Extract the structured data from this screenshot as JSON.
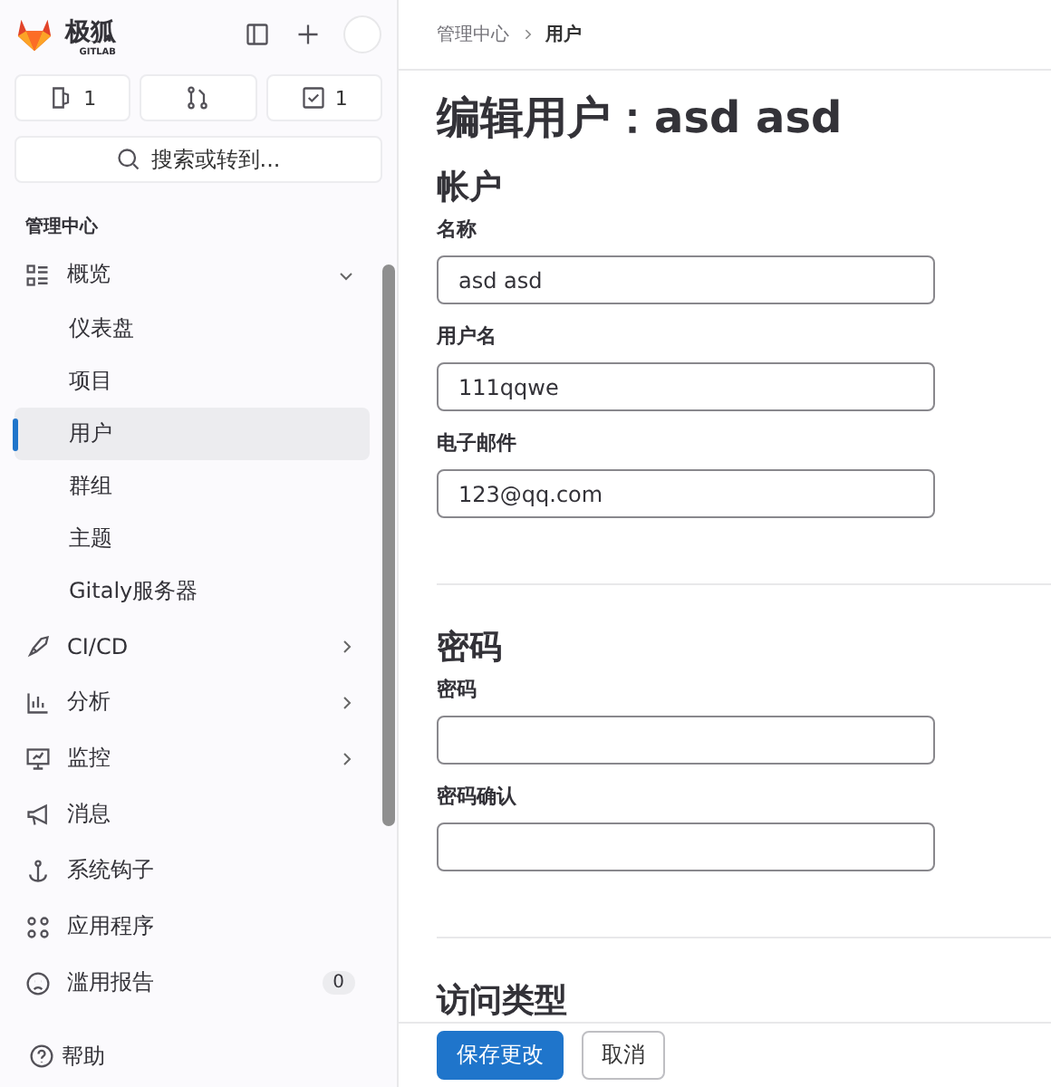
{
  "brand": {
    "name": "极狐",
    "sub": "GITLAB"
  },
  "counters": [
    {
      "kind": "issues",
      "count": "1"
    },
    {
      "kind": "merge"
    },
    {
      "kind": "todo",
      "count": "1"
    }
  ],
  "search": {
    "placeholder": "搜索或转到..."
  },
  "sidebar": {
    "section": "管理中心",
    "items": [
      {
        "label": "概览",
        "selected": false,
        "expanded": true,
        "children": [
          {
            "label": "仪表盘",
            "selected": false
          },
          {
            "label": "项目",
            "selected": false
          },
          {
            "label": "用户",
            "selected": true
          },
          {
            "label": "群组",
            "selected": false
          },
          {
            "label": "主题",
            "selected": false
          },
          {
            "label": "Gitaly服务器",
            "selected": false
          }
        ]
      },
      {
        "label": "CI/CD",
        "selected": false,
        "expanded": false
      },
      {
        "label": "分析",
        "selected": false,
        "expanded": false
      },
      {
        "label": "监控",
        "selected": false,
        "expanded": false
      },
      {
        "label": "消息",
        "selected": false
      },
      {
        "label": "系统钩子",
        "selected": false
      },
      {
        "label": "应用程序",
        "selected": false
      },
      {
        "label": "滥用报告",
        "selected": false,
        "badge": "0"
      }
    ]
  },
  "help": "帮助",
  "breadcrumb": [
    "管理中心",
    "用户"
  ],
  "title": "编辑用户：asd asd",
  "sections": [
    {
      "heading": "帐户",
      "fields": [
        {
          "label": "名称",
          "value": "asd asd"
        },
        {
          "label": "用户名",
          "value": "111qqwe"
        },
        {
          "label": "电子邮件",
          "value": "123@qq.com"
        }
      ]
    },
    {
      "heading": "密码",
      "fields": [
        {
          "label": "密码"
        },
        {
          "label": "密码确认"
        }
      ]
    },
    {
      "heading": "访问类型"
    }
  ],
  "buttons": [
    {
      "kind": "primary",
      "label": "保存更改"
    },
    {
      "kind": "secondary",
      "label": "取消"
    }
  ]
}
